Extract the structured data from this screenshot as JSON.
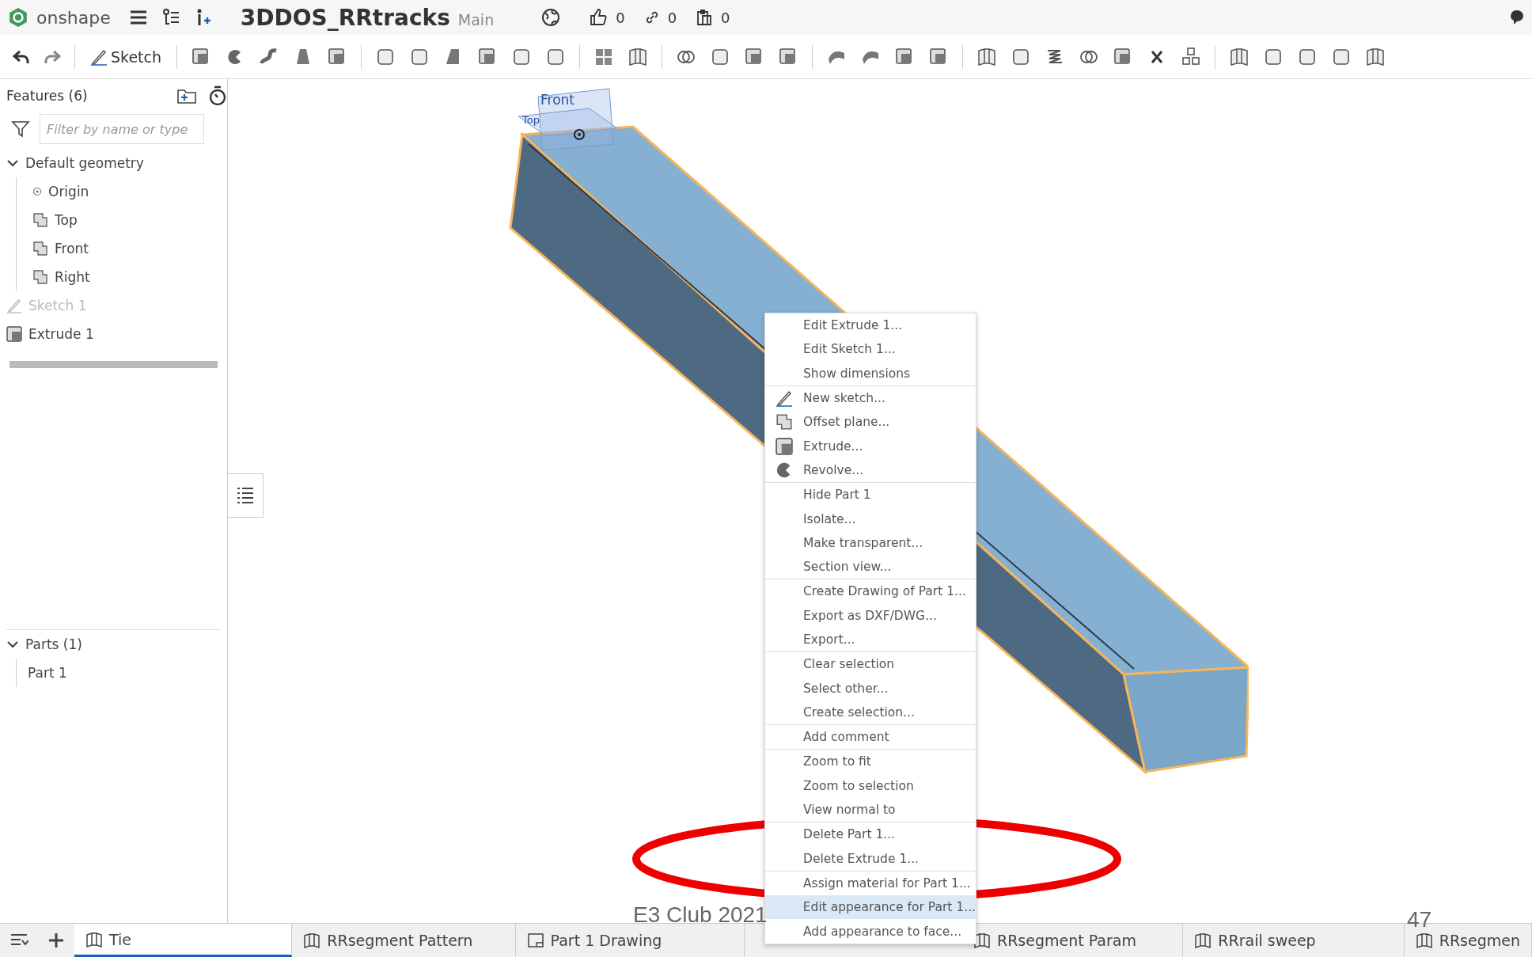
{
  "top_bar": {
    "logo": "onshape",
    "document_title": "3DDOS_RRtracks",
    "workspace": "Main",
    "likes": "0",
    "links": "0",
    "copies": "0"
  },
  "toolbar": {
    "sketch_button": "Sketch"
  },
  "features_panel": {
    "title": "Features (6)",
    "filter": {
      "placeholder": "Filter by name or type"
    },
    "tree": [
      {
        "label": "Default geometry",
        "kind": "group",
        "expanded": true,
        "disabled": false,
        "children": [
          {
            "label": "Origin",
            "kind": "origin",
            "disabled": false
          },
          {
            "label": "Top",
            "kind": "plane",
            "disabled": false
          },
          {
            "label": "Front",
            "kind": "plane",
            "disabled": false
          },
          {
            "label": "Right",
            "kind": "plane",
            "disabled": false
          }
        ]
      },
      {
        "label": "Sketch 1",
        "kind": "sketch",
        "disabled": true
      },
      {
        "label": "Extrude 1",
        "kind": "extrude",
        "disabled": false
      }
    ],
    "parts": {
      "label": "Parts (1)",
      "expanded": true,
      "children": [
        {
          "label": "Part 1"
        }
      ]
    }
  },
  "viewport": {
    "plane_labels": [
      "Front",
      "Top"
    ]
  },
  "context_menu": {
    "groups": [
      [
        {
          "label": "Edit Extrude 1...",
          "kind": "plain",
          "selected": false
        },
        {
          "label": "Edit Sketch 1...",
          "kind": "plain",
          "selected": false
        },
        {
          "label": "Show dimensions",
          "kind": "plain",
          "selected": false
        }
      ],
      [
        {
          "label": "New sketch...",
          "kind": "sketch",
          "selected": false
        },
        {
          "label": "Offset plane...",
          "kind": "plane",
          "selected": false
        },
        {
          "label": "Extrude...",
          "kind": "extrude",
          "selected": false
        },
        {
          "label": "Revolve...",
          "kind": "revolve",
          "selected": false
        }
      ],
      [
        {
          "label": "Hide Part 1",
          "kind": "plain",
          "selected": false
        },
        {
          "label": "Isolate...",
          "kind": "plain",
          "selected": false
        },
        {
          "label": "Make transparent...",
          "kind": "plain",
          "selected": false
        },
        {
          "label": "Section view...",
          "kind": "plain",
          "selected": false
        }
      ],
      [
        {
          "label": "Create Drawing of Part 1...",
          "kind": "plain",
          "selected": false
        },
        {
          "label": "Export as DXF/DWG...",
          "kind": "plain",
          "selected": false
        },
        {
          "label": "Export...",
          "kind": "plain",
          "selected": false
        }
      ],
      [
        {
          "label": "Clear selection",
          "kind": "plain",
          "selected": false
        },
        {
          "label": "Select other...",
          "kind": "plain",
          "selected": false
        },
        {
          "label": "Create selection...",
          "kind": "plain",
          "selected": false
        }
      ],
      [
        {
          "label": "Add comment",
          "kind": "plain",
          "selected": false
        }
      ],
      [
        {
          "label": "Zoom to fit",
          "kind": "plain",
          "selected": false
        },
        {
          "label": "Zoom to selection",
          "kind": "plain",
          "selected": false
        },
        {
          "label": "View normal to",
          "kind": "plain",
          "selected": false
        }
      ],
      [
        {
          "label": "Delete Part 1...",
          "kind": "plain",
          "selected": false
        },
        {
          "label": "Delete Extrude 1...",
          "kind": "plain",
          "selected": false
        }
      ],
      [
        {
          "label": "Assign material for Part 1...",
          "kind": "plain",
          "selected": false
        },
        {
          "label": "Edit appearance for Part 1...",
          "kind": "plain",
          "selected": true
        },
        {
          "label": "Add appearance to face...",
          "kind": "plain",
          "selected": false
        }
      ]
    ]
  },
  "tabs": [
    {
      "label": "Tie",
      "kind": "part",
      "selected": true
    },
    {
      "label": "RRsegment Pattern",
      "kind": "part",
      "selected": false
    },
    {
      "label": "Part 1 Drawing",
      "kind": "drawing",
      "selected": false
    },
    {
      "label": "RRsegment Param",
      "kind": "part",
      "selected": false
    },
    {
      "label": "RRrail sweep",
      "kind": "part",
      "selected": false
    },
    {
      "label": "RRsegmen",
      "kind": "part",
      "selected": false
    }
  ],
  "slide_footer": {
    "caption": "E3 Club 2021",
    "page_number": "47"
  }
}
